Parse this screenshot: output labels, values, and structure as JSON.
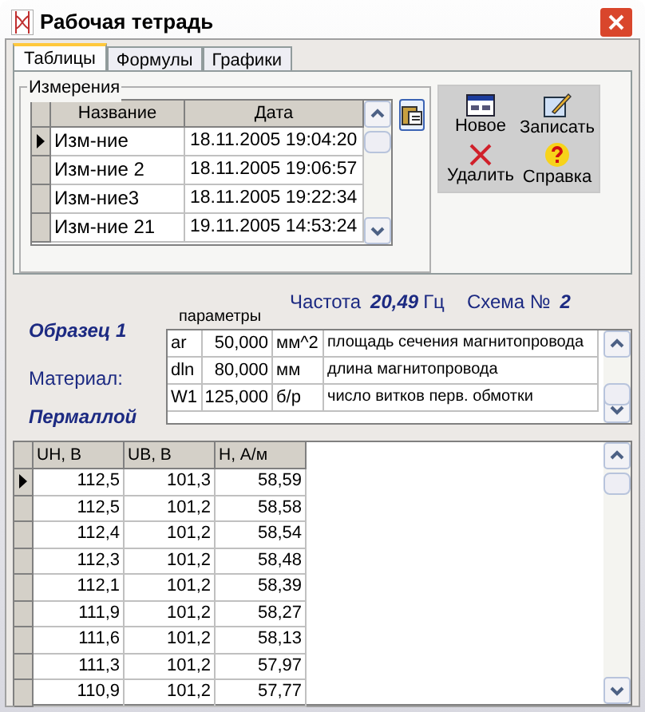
{
  "window": {
    "title": "Рабочая тетрадь"
  },
  "tabs": [
    {
      "label": "Таблицы",
      "selected": true
    },
    {
      "label": "Формулы",
      "selected": false
    },
    {
      "label": "Графики",
      "selected": false
    }
  ],
  "measurements": {
    "group_label": "Измерения",
    "columns": [
      "Название",
      "Дата"
    ],
    "rows": [
      {
        "name": "Изм-ние",
        "date": "18.11.2005 19:04:20",
        "selected": true
      },
      {
        "name": "Изм-ние 2",
        "date": "18.11.2005 19:06:57",
        "selected": false
      },
      {
        "name": "Изм-ние3",
        "date": "18.11.2005 19:22:34",
        "selected": false
      },
      {
        "name": "Изм-ние 21",
        "date": "19.11.2005 14:53:24",
        "selected": false
      }
    ]
  },
  "actions": [
    {
      "label": "Новое",
      "kind": "new"
    },
    {
      "label": "Записать",
      "kind": "save"
    },
    {
      "label": "Удалить",
      "kind": "delete"
    },
    {
      "label": "Справка",
      "kind": "help"
    }
  ],
  "sample": {
    "title": "Образец 1",
    "params_label": "параметры",
    "frequency_label": "Частота",
    "frequency_value": "20,49",
    "frequency_unit": "Гц",
    "scheme_label": "Схема №",
    "scheme_value": "2",
    "material_label": "Материал:",
    "material_value": "Пермаллой"
  },
  "params": [
    {
      "name": "ar",
      "value": "50,000",
      "unit": "мм^2",
      "description": "площадь сечения магнитопровода"
    },
    {
      "name": "dln",
      "value": "80,000",
      "unit": "мм",
      "description": "длина магнитопровода"
    },
    {
      "name": "W1",
      "value": "125,000",
      "unit": "б/р",
      "description": "число витков перв. обмотки"
    }
  ],
  "data": {
    "columns": [
      "UH, В",
      "UB, В",
      "H, А/м"
    ],
    "rows": [
      {
        "cells": [
          "112,5",
          "101,3",
          "58,59"
        ],
        "selected": true
      },
      {
        "cells": [
          "112,5",
          "101,2",
          "58,58"
        ],
        "selected": false
      },
      {
        "cells": [
          "112,4",
          "101,2",
          "58,54"
        ],
        "selected": false
      },
      {
        "cells": [
          "112,3",
          "101,2",
          "58,48"
        ],
        "selected": false
      },
      {
        "cells": [
          "112,1",
          "101,2",
          "58,39"
        ],
        "selected": false
      },
      {
        "cells": [
          "111,9",
          "101,2",
          "58,27"
        ],
        "selected": false
      },
      {
        "cells": [
          "111,6",
          "101,2",
          "58,13"
        ],
        "selected": false
      },
      {
        "cells": [
          "111,3",
          "101,2",
          "57,97"
        ],
        "selected": false
      },
      {
        "cells": [
          "110,9",
          "101,2",
          "57,77"
        ],
        "selected": false
      }
    ]
  }
}
